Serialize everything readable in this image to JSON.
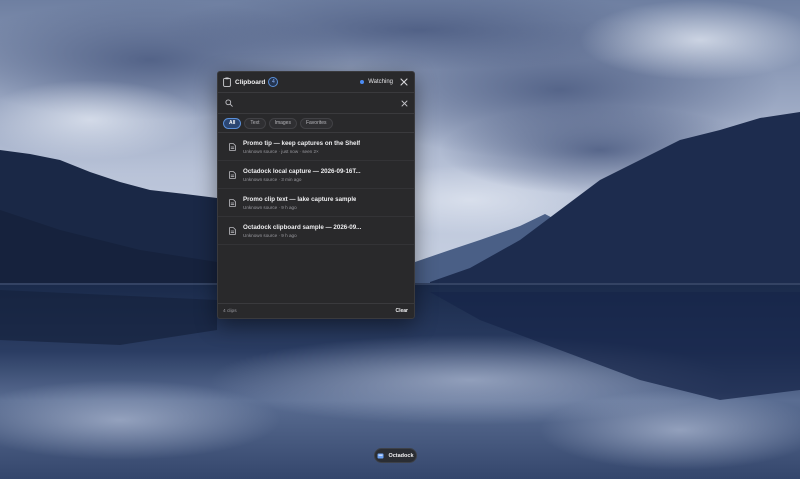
{
  "panel": {
    "title": "Clipboard",
    "badge": "4",
    "watching": "Watching",
    "search": {
      "value": "",
      "placeholder": ""
    },
    "filters": [
      "All",
      "Text",
      "Images",
      "Favorites"
    ],
    "active_filter": "All",
    "items": [
      {
        "title": "Promo tip — keep captures on the Shelf",
        "meta": "Unknown source · just now · seen 2×"
      },
      {
        "title": "Octadock local capture — 2026-09-16T...",
        "meta": "Unknown source · 3 min ago"
      },
      {
        "title": "Promo clip text — lake capture sample",
        "meta": "Unknown source · 9 h ago"
      },
      {
        "title": "Octadock clipboard sample — 2026-09...",
        "meta": "Unknown source · 9 h ago"
      }
    ],
    "footer": {
      "count": "4 clips",
      "clear": "Clear"
    }
  },
  "dock": {
    "label": "Octadock"
  },
  "icons": {
    "title": "clipboard-icon",
    "search": "search-icon",
    "close": "close-icon",
    "clear_search": "clear-search-icon",
    "item": "document-icon",
    "dock": "octadock-app-icon"
  },
  "colors": {
    "accent": "#4c8cf5",
    "panel_bg": "#29292b",
    "chip_active": "#2b4672"
  }
}
